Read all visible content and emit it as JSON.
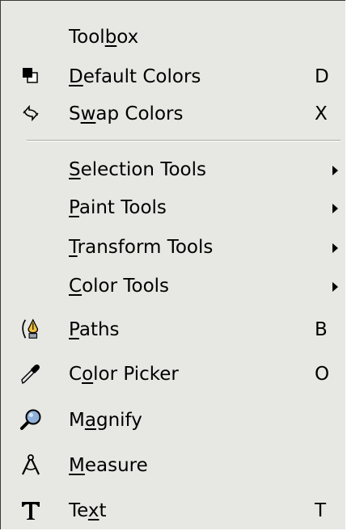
{
  "menu": {
    "header": {
      "pre": "Tool",
      "ul": "b",
      "post": "ox"
    },
    "items": [
      {
        "pre": "",
        "ul": "D",
        "post": "efault Colors",
        "shortcut": "D",
        "icon": "default-colors-icon"
      },
      {
        "pre": "S",
        "ul": "w",
        "post": "ap Colors",
        "shortcut": "X",
        "icon": "swap-colors-icon"
      },
      {
        "pre": "",
        "ul": "S",
        "post": "election Tools",
        "submenu": true
      },
      {
        "pre": "",
        "ul": "P",
        "post": "aint Tools",
        "submenu": true
      },
      {
        "pre": "",
        "ul": "T",
        "post": "ransform Tools",
        "submenu": true
      },
      {
        "pre": "",
        "ul": "C",
        "post": "olor Tools",
        "submenu": true
      },
      {
        "pre": "",
        "ul": "P",
        "post": "aths",
        "shortcut": "B",
        "icon": "paths-icon"
      },
      {
        "pre": "C",
        "ul": "o",
        "post": "lor Picker",
        "shortcut": "O",
        "icon": "color-picker-icon"
      },
      {
        "pre": "M",
        "ul": "a",
        "post": "gnify",
        "icon": "magnify-icon"
      },
      {
        "pre": "",
        "ul": "M",
        "post": "easure",
        "icon": "measure-icon"
      },
      {
        "pre": "Te",
        "ul": "x",
        "post": "t",
        "shortcut": "T",
        "icon": "text-icon"
      }
    ]
  }
}
